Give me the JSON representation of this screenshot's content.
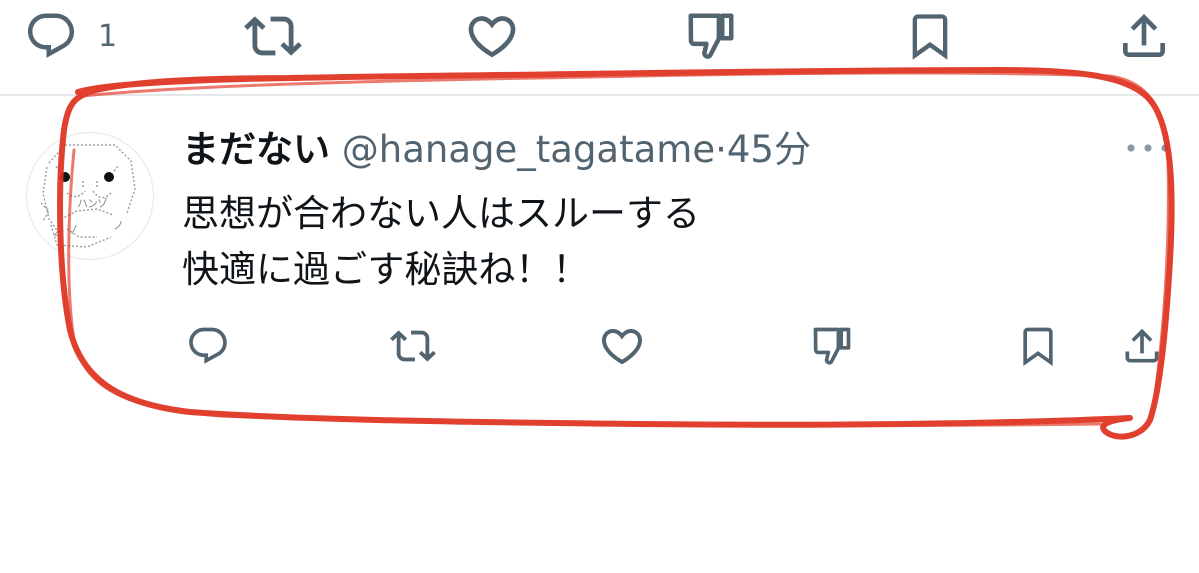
{
  "top_actions": {
    "reply_count": "1"
  },
  "tweet": {
    "display_name": "まだない",
    "handle": "@hanage_tagatame",
    "separator": "·",
    "time": "45分",
    "lines": [
      "思想が合わない人はスルーする",
      "快適に過ごす秘訣ね！！"
    ]
  },
  "colors": {
    "icon_gray": "#536471",
    "text": "#0f1419",
    "annotation_red": "#e0301e",
    "divider": "#e4e8eb"
  },
  "icons": {
    "actions": [
      "reply-icon",
      "retweet-icon",
      "like-icon",
      "downvote-icon",
      "bookmark-icon",
      "share-icon"
    ],
    "more": "more-icon"
  }
}
